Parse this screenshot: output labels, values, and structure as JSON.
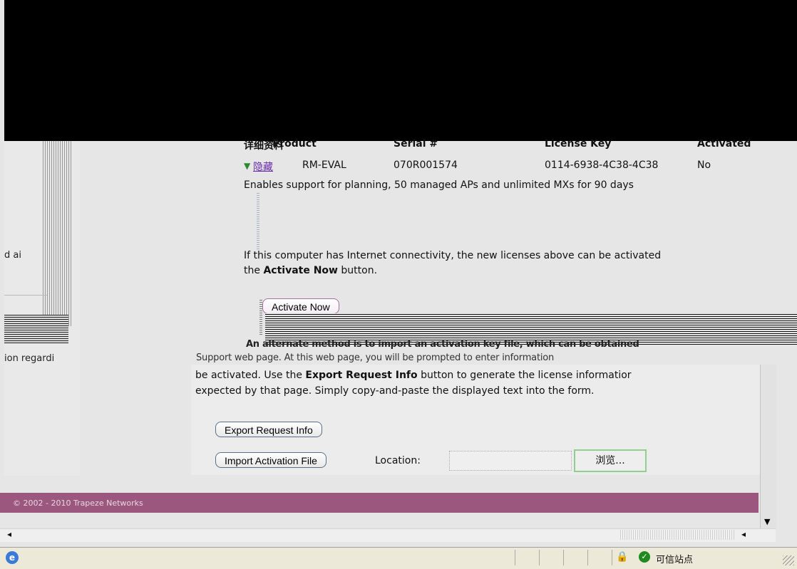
{
  "table_header": {
    "col1": "详细资料",
    "product": "Product",
    "serial": "Serial #",
    "license_key": "License Key",
    "activated": "Activated"
  },
  "license_row": {
    "hide_link": "隐藏",
    "product": "RM-EVAL",
    "serial": "070R001574",
    "license_key": "0114-6938-4C38-4C38",
    "activated": "No"
  },
  "description": "Enables support for planning, 50 managed APs and unlimited MXs for 90 days",
  "activate_paragraph": {
    "part1": "If this computer has Internet connectivity, the new licenses above can be activated",
    "part2_pre": "the ",
    "part2_bold": "Activate Now",
    "part2_post": " button."
  },
  "buttons": {
    "activate_now": "Activate Now",
    "export_request_info": "Export Request Info",
    "import_activation_file": "Import Activation File",
    "browse": "浏览..."
  },
  "overlap_text": {
    "line1": "An alternate method is to import an activation key file, which can be obtained",
    "line2": "Support web page. At this web page, you will be prompted to enter information"
  },
  "export_paragraph": {
    "line1_pre": "be activated. Use the ",
    "line1_bold": "Export Request Info",
    "line1_post": " button to generate the license informatior",
    "line2": "expected by that page. Simply copy-and-paste the displayed text into the form."
  },
  "location_label": "Location:",
  "left_fragments": {
    "frag1": "d ai",
    "frag2": "ion regardi"
  },
  "footer": {
    "copyright": "© 2002 - 2010 Trapeze Networks"
  },
  "statusbar": {
    "zone": "可信站点"
  },
  "colors": {
    "footer_bg": "#9b577d",
    "link": "#6a2aa8",
    "page_bg": "#e6e6e6"
  }
}
